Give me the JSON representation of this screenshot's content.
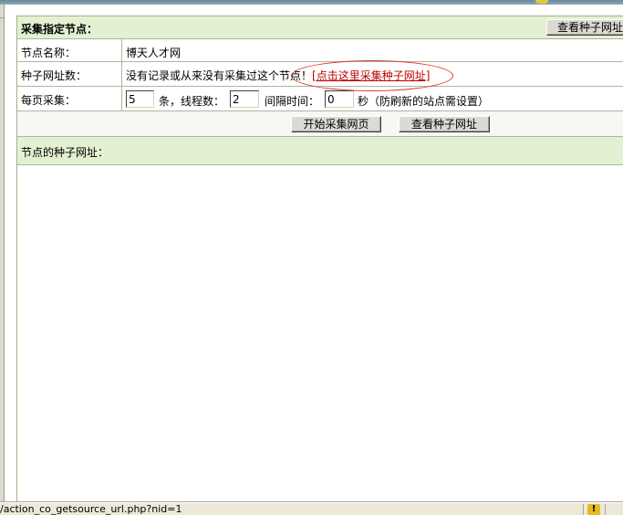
{
  "header": {
    "title": "采集指定节点：",
    "view_seed_button": "查看种子网址"
  },
  "form": {
    "node_name_label": "节点名称：",
    "node_name_value": "博天人才网",
    "seed_count_label": "种子网址数：",
    "seed_message": "没有记录或从来没有采集过这个节点！",
    "seed_link_text": "[点击这里采集种子网址]",
    "per_page_label": "每页采集：",
    "per_page_value": "5",
    "per_page_unit": "条，线程数：",
    "threads_value": "2",
    "interval_label": "间隔时间：",
    "interval_value": "0",
    "interval_unit": "秒（防刷新的站点需设置）"
  },
  "actions": {
    "start_button": "开始采集网页",
    "view_seed_button": "查看种子网址"
  },
  "seeds_panel": {
    "title": "节点的种子网址："
  },
  "statusbar": {
    "url": "/action_co_getsource_url.php?nid=1",
    "warning_icon": "warning-icon"
  }
}
